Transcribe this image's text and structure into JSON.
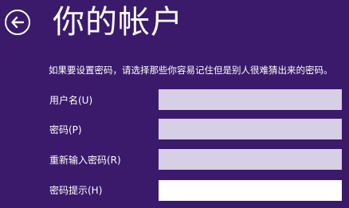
{
  "header": {
    "title": "你的帐户",
    "back_icon": "back-arrow-icon"
  },
  "form": {
    "description": "如果要设置密码，请选择那些你容易记住但是别人很难猜出来的密码。",
    "fields": [
      {
        "label": "用户名(U)",
        "value": ""
      },
      {
        "label": "密码(P)",
        "value": ""
      },
      {
        "label": "重新输入密码(R)",
        "value": ""
      },
      {
        "label": "密码提示(H)",
        "value": ""
      }
    ]
  },
  "colors": {
    "background": "#3b1a6b",
    "text": "#ffffff",
    "input_inactive": "#d6cfe6",
    "input_active": "#ffffff"
  }
}
